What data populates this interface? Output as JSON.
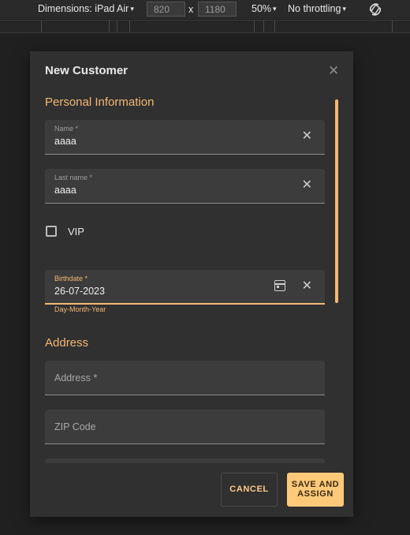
{
  "devtools": {
    "dimensions_label": "Dimensions: iPad Air",
    "width_value": "820",
    "times_symbol": "x",
    "height_value": "1180",
    "zoom": "50%",
    "throttling": "No throttling",
    "caret": "▾",
    "rotate_icon": "rotate-icon"
  },
  "dialog": {
    "title": "New Customer",
    "close_symbol": "✕",
    "personal_section": "Personal Information",
    "name": {
      "label": "Name *",
      "value": "aaaa"
    },
    "last_name": {
      "label": "Last name *",
      "value": "aaaa"
    },
    "vip_label": "VIP",
    "birthdate": {
      "label": "Birthdate *",
      "value": "26-07-2023",
      "hint": "Day-Month-Year"
    },
    "address_section": "Address",
    "address": {
      "placeholder": "Address *"
    },
    "zip": {
      "placeholder": "ZIP Code"
    },
    "clear_symbol": "✕",
    "cancel_label": "CANCEL",
    "save_label_line1": "SAVE AND",
    "save_label_line2": "ASSIGN"
  },
  "colors": {
    "accent": "#f4b872",
    "save_button": "#ffc97a",
    "dialog_bg": "#303030",
    "field_bg": "#3c3c3c"
  }
}
